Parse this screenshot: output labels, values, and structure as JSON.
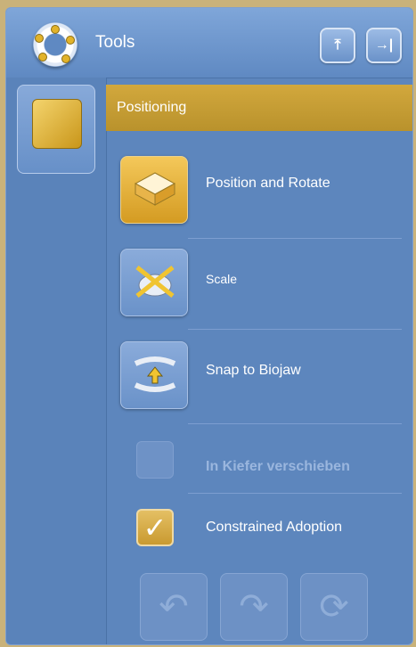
{
  "header": {
    "title": "Tools",
    "buttons": [
      {
        "name": "collapse-up",
        "icon": "arrow-up-bar-icon",
        "glyph": "⤒"
      },
      {
        "name": "dock-right",
        "icon": "arrow-right-bar-icon",
        "glyph": "→|"
      }
    ]
  },
  "sidebar": {
    "tabs": [
      {
        "name": "positioning-tab",
        "icon": "positioning-icon"
      }
    ]
  },
  "section": {
    "title": "Positioning"
  },
  "tools": [
    {
      "label": "Position and Rotate",
      "icon": "position-rotate-icon",
      "active": true
    },
    {
      "label": "Scale",
      "icon": "scale-icon",
      "active": false
    },
    {
      "label": "Snap to Biojaw",
      "icon": "snap-biojaw-icon",
      "active": false
    }
  ],
  "options": [
    {
      "label": "In Kiefer verschieben",
      "checked": false,
      "enabled": false
    },
    {
      "label": "Constrained Adoption",
      "checked": true,
      "enabled": true
    }
  ],
  "actions": [
    {
      "name": "undo",
      "icon": "undo-icon",
      "glyph": "↶"
    },
    {
      "name": "redo",
      "icon": "redo-icon",
      "glyph": "↷"
    },
    {
      "name": "reset",
      "icon": "reset-icon",
      "glyph": "⟳"
    }
  ],
  "colors": {
    "panel": "#5d86bd",
    "accent": "#c9a035",
    "text": "#ffffff",
    "disabled_text": "#9ab6de"
  }
}
